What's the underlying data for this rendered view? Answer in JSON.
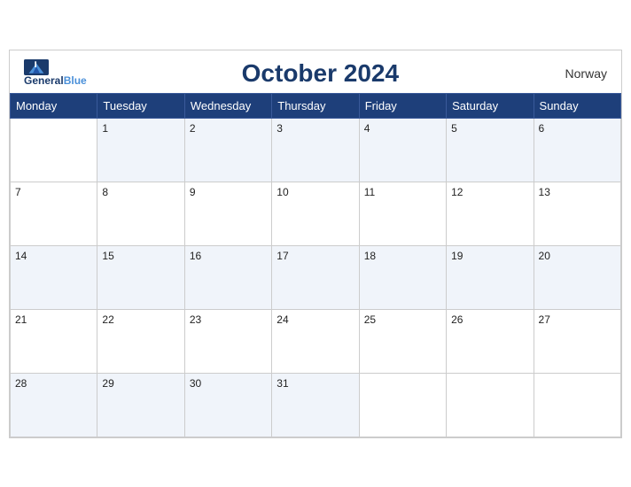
{
  "header": {
    "logo_line1": "General",
    "logo_line2": "Blue",
    "month_title": "October 2024",
    "country": "Norway"
  },
  "days_of_week": [
    "Monday",
    "Tuesday",
    "Wednesday",
    "Thursday",
    "Friday",
    "Saturday",
    "Sunday"
  ],
  "weeks": [
    [
      "",
      "1",
      "2",
      "3",
      "4",
      "5",
      "6"
    ],
    [
      "7",
      "8",
      "9",
      "10",
      "11",
      "12",
      "13"
    ],
    [
      "14",
      "15",
      "16",
      "17",
      "18",
      "19",
      "20"
    ],
    [
      "21",
      "22",
      "23",
      "24",
      "25",
      "26",
      "27"
    ],
    [
      "28",
      "29",
      "30",
      "31",
      "",
      "",
      ""
    ]
  ]
}
